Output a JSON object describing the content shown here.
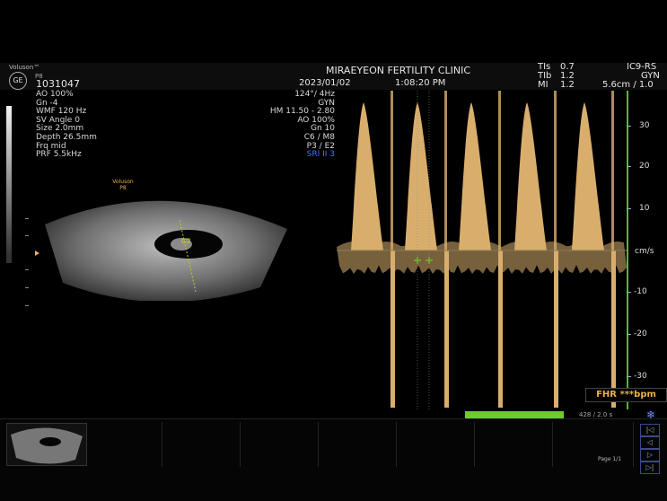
{
  "header": {
    "brand": "Voluson™",
    "probe_top": "P8",
    "patient_id": "1031047",
    "clinic": "MIRAEYEON FERTILITY CLINIC",
    "date": "2023/01/02",
    "time": "1:08:20 PM",
    "tis_label": "TIs",
    "tis_value": "0.7",
    "tib_label": "TIb",
    "tib_value": "1.2",
    "mi_label": "MI",
    "mi_value": "1.2",
    "probe": "IC9-RS",
    "preset": "GYN",
    "depth_scale": "5.6cm / 1.0"
  },
  "left_params": [
    "AO 100%",
    "Gn -4",
    "WMF 120 Hz",
    "SV Angle 0",
    "Size 2.0mm",
    "Depth 26.5mm",
    "Frq mid",
    "PRF 5.5kHz"
  ],
  "mid_params": [
    "124°/ 4Hz",
    "GYN",
    "HM 11.50 - 2.80",
    "AO 100%",
    "Gn 10",
    "C6 / M8",
    "P3 / E2",
    "SRI II 3"
  ],
  "image_label": {
    "brand": "Voluson",
    "probe": "P8"
  },
  "scale": {
    "unit": "cm/s",
    "ticks": [
      {
        "label": "30",
        "value": 30
      },
      {
        "label": "20",
        "value": 20
      },
      {
        "label": "10",
        "value": 10
      },
      {
        "label": "-10",
        "value": -10
      },
      {
        "label": "-20",
        "value": -20
      },
      {
        "label": "-30",
        "value": -30
      }
    ]
  },
  "fhr": "FHR ***bpm",
  "sweep": "428 / 2.0 s",
  "page": "Page 1/1",
  "nav_buttons": [
    "|◁",
    "◁",
    "▷",
    "▷|"
  ],
  "colors": {
    "doppler": "#f2c27a",
    "green": "#6ecb2a",
    "fhr": "#e8b14a",
    "sri": "#4a6cff"
  },
  "icons": {
    "settings": "snowflake-icon",
    "logo": "ge-logo-icon"
  }
}
